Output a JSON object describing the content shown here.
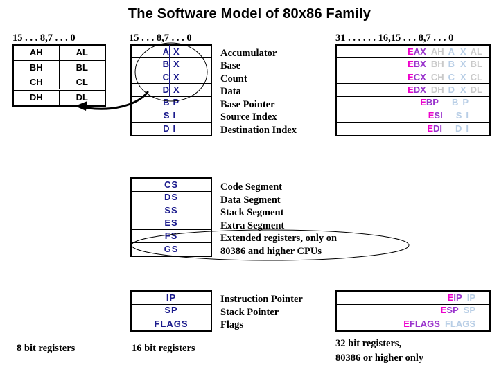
{
  "slide": {
    "title": "The Software Model of 80x86 Family"
  },
  "headers": {
    "bits16_left": "15 . . . 8,7 . . . 0",
    "bits16_mid": "15 . . . 8,7 . . . 0",
    "bits32": "31 . . . . . . 16,15 . . . 8,7 . . . 0"
  },
  "captions": {
    "reg8": "8 bit registers",
    "reg16": "16 bit registers",
    "reg32_line1": "32 bit registers,",
    "reg32_line2": "80386 or higher only"
  },
  "colors": {
    "border": "#000000",
    "text_8bit": "#000000",
    "text_16bit": "#1a1a8c",
    "text_32bit_e": "#ee00cc",
    "text_32bit_word": "#9933cc",
    "ghost_high": "#c9c9c9",
    "ghost_low": "#b8cee6",
    "background": "#ffffff"
  },
  "table_8bit": {
    "rows": [
      {
        "high": "AH",
        "low": "AL"
      },
      {
        "high": "BH",
        "low": "BL"
      },
      {
        "high": "CH",
        "low": "CL"
      },
      {
        "high": "DH",
        "low": "DL"
      }
    ]
  },
  "table_16bit_general": {
    "rows": [
      {
        "high": "A",
        "low": "X",
        "split": true,
        "description": "Accumulator"
      },
      {
        "high": "B",
        "low": "X",
        "split": true,
        "description": "Base"
      },
      {
        "high": "C",
        "low": "X",
        "split": true,
        "description": "Count"
      },
      {
        "high": "D",
        "low": "X",
        "split": true,
        "description": "Data"
      },
      {
        "high": "B",
        "low": "P",
        "split": false,
        "description": "Base Pointer"
      },
      {
        "high": "S",
        "low": "I",
        "split": false,
        "description": "Source Index"
      },
      {
        "high": "D",
        "low": "I",
        "split": false,
        "description": "Destination Index"
      }
    ]
  },
  "table_16bit_segment": {
    "rows": [
      {
        "name": "CS",
        "description": "Code Segment"
      },
      {
        "name": "DS",
        "description": "Data Segment"
      },
      {
        "name": "SS",
        "description": "Stack Segment"
      },
      {
        "name": "ES",
        "description": "Extra Segment"
      },
      {
        "name": "FS",
        "description": "Extended registers, only on"
      },
      {
        "name": "GS",
        "description": "80386 and higher CPUs"
      }
    ]
  },
  "table_16bit_pointer": {
    "rows": [
      {
        "name": "IP",
        "description": "Instruction Pointer"
      },
      {
        "name": "SP",
        "description": "Stack Pointer"
      },
      {
        "name": "FLAGS",
        "description": "Flags"
      }
    ]
  },
  "table_32bit_general": {
    "rows": [
      {
        "prefix": "E",
        "word": "AX",
        "ghost_high": "AH",
        "ghost_mid_hi": "A",
        "ghost_mid_lo": "X",
        "ghost_low": "AL",
        "split": true
      },
      {
        "prefix": "E",
        "word": "BX",
        "ghost_high": "BH",
        "ghost_mid_hi": "B",
        "ghost_mid_lo": "X",
        "ghost_low": "BL",
        "split": true
      },
      {
        "prefix": "E",
        "word": "CX",
        "ghost_high": "CH",
        "ghost_mid_hi": "C",
        "ghost_mid_lo": "X",
        "ghost_low": "CL",
        "split": true
      },
      {
        "prefix": "E",
        "word": "DX",
        "ghost_high": "DH",
        "ghost_mid_hi": "D",
        "ghost_mid_lo": "X",
        "ghost_low": "DL",
        "split": true
      },
      {
        "prefix": "E",
        "word": "BP",
        "ghost_high": "",
        "ghost_mid_hi": "B",
        "ghost_mid_lo": "P",
        "ghost_low": "",
        "split": false
      },
      {
        "prefix": "E",
        "word": "SI",
        "ghost_high": "",
        "ghost_mid_hi": "S",
        "ghost_mid_lo": "I",
        "ghost_low": "",
        "split": false
      },
      {
        "prefix": "E",
        "word": "DI",
        "ghost_high": "",
        "ghost_mid_hi": "D",
        "ghost_mid_lo": "I",
        "ghost_low": "",
        "split": false
      }
    ]
  },
  "table_32bit_pointer": {
    "rows": [
      {
        "prefix": "E",
        "word": "IP",
        "ghost": "IP"
      },
      {
        "prefix": "E",
        "word": "SP",
        "ghost": "SP"
      },
      {
        "prefix": "E",
        "word": "FLAGS",
        "ghost": "FLAGS"
      }
    ]
  }
}
